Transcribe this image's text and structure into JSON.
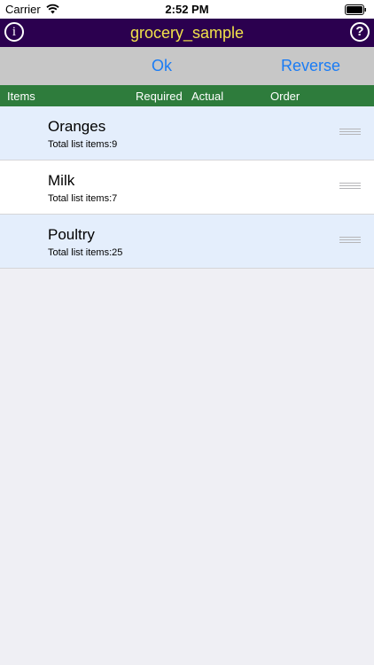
{
  "status_bar": {
    "carrier": "Carrier",
    "time": "2:52 PM",
    "icons": [
      "wifi-icon",
      "battery-icon"
    ]
  },
  "title_bar": {
    "title": "grocery_sample",
    "left_icon": "info-icon",
    "right_icon": "help-icon",
    "info_glyph": "i",
    "help_glyph": "?"
  },
  "toolbar": {
    "ok_label": "Ok",
    "reverse_label": "Reverse"
  },
  "columns": {
    "items": "Items",
    "required": "Required",
    "actual": "Actual",
    "order": "Order"
  },
  "lists": [
    {
      "name": "Oranges",
      "count_text": "Total list items:9"
    },
    {
      "name": "Milk",
      "count_text": "Total list items:7"
    },
    {
      "name": "Poultry",
      "count_text": "Total list items:25"
    }
  ],
  "colors": {
    "title_bar_bg": "#2b004f",
    "title_text": "#f2e24a",
    "header_bg": "#2e7c3c",
    "button_text": "#1a7cf5",
    "row_shaded": "#e4eefc"
  }
}
